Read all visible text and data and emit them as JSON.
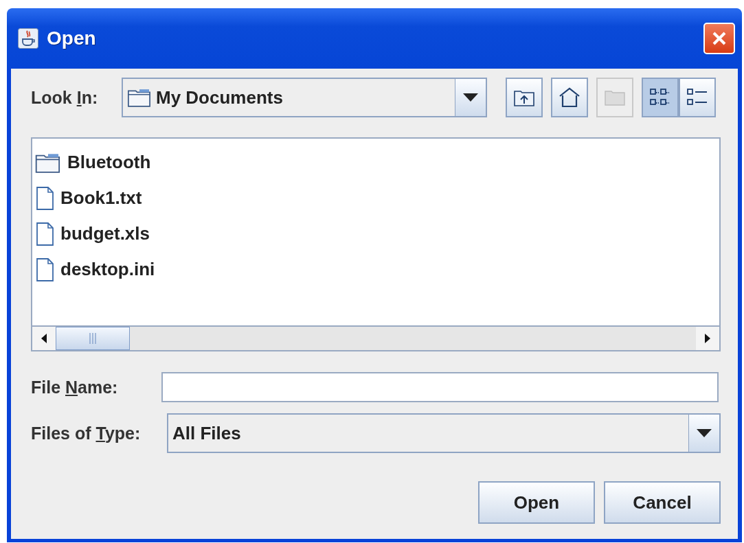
{
  "window": {
    "title": "Open"
  },
  "look_in": {
    "label": {
      "before": "Look ",
      "key": "I",
      "after": "n:"
    },
    "value": "My Documents"
  },
  "toolbar": [
    {
      "kind": "up",
      "disabled": false,
      "selected": false
    },
    {
      "kind": "home",
      "disabled": false,
      "selected": false
    },
    {
      "kind": "new-folder",
      "disabled": true,
      "selected": false
    },
    {
      "kind": "list",
      "disabled": false,
      "selected": true
    },
    {
      "kind": "details",
      "disabled": false,
      "selected": false
    }
  ],
  "files": [
    {
      "kind": "folder",
      "name": "Bluetooth"
    },
    {
      "kind": "file",
      "name": "Book1.txt"
    },
    {
      "kind": "file",
      "name": "budget.xls"
    },
    {
      "kind": "file",
      "name": "desktop.ini"
    }
  ],
  "file_name": {
    "label": {
      "before": "File ",
      "key": "N",
      "after": "ame:"
    }
  },
  "files_of_type": {
    "label": {
      "before": "Files of ",
      "key": "T",
      "after": "ype:"
    },
    "value": "All Files"
  },
  "buttons": [
    "Open",
    "Cancel"
  ]
}
